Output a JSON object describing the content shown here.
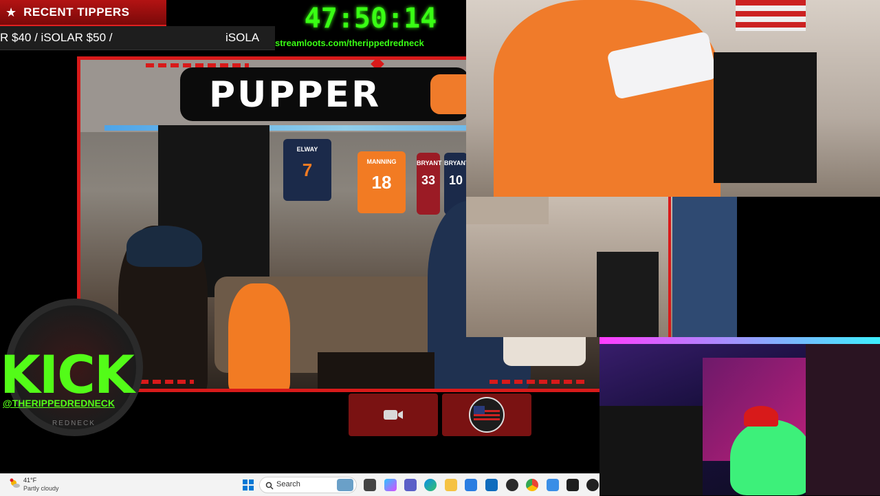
{
  "tippers": {
    "star_icon": "star-icon",
    "title": "RECENT TIPPERS",
    "ticker_left": "R $40 / iSOLAR $50 /",
    "ticker_right": "iSOLA"
  },
  "timer": "47:50:14",
  "streamloots_url": "streamloots.com/therippedredneck",
  "main_cam": {
    "banner": "PUPPER",
    "jerseys": [
      {
        "name": "ELWAY",
        "number": "7",
        "color": "#1b2a4a",
        "text": "#f27b23"
      },
      {
        "name": "MANNING",
        "number": "18",
        "color": "#f27b23",
        "text": "#fff"
      },
      {
        "name": "BRYANT",
        "number": "33",
        "color": "#9b1b25",
        "text": "#fff"
      },
      {
        "name": "BRYANT",
        "number": "10",
        "color": "#1b2a4a",
        "text": "#fff"
      }
    ]
  },
  "kick": {
    "logo_text": "KICK",
    "handle": "@THERIPPEDREDNECK",
    "subtext": "REDNECK"
  },
  "toolbar": {
    "camera_icon": "camera-icon",
    "avatar_icon": "flag-avatar-icon"
  },
  "taskbar": {
    "weather_temp": "41°F",
    "weather_condition": "Partly cloudy",
    "search_placeholder": "Search",
    "icons": [
      "windows-start-icon",
      "search-icon",
      "task-view-icon",
      "copilot-icon",
      "teams-icon",
      "edge-icon",
      "file-explorer-icon",
      "store-icon",
      "outlook-icon",
      "obs-icon",
      "chrome-icon",
      "photos-icon",
      "terminal-icon",
      "app-icon"
    ]
  },
  "colors": {
    "accent_red": "#d81a1a",
    "timer_green": "#39ff14",
    "kick_green": "#53fc18"
  }
}
